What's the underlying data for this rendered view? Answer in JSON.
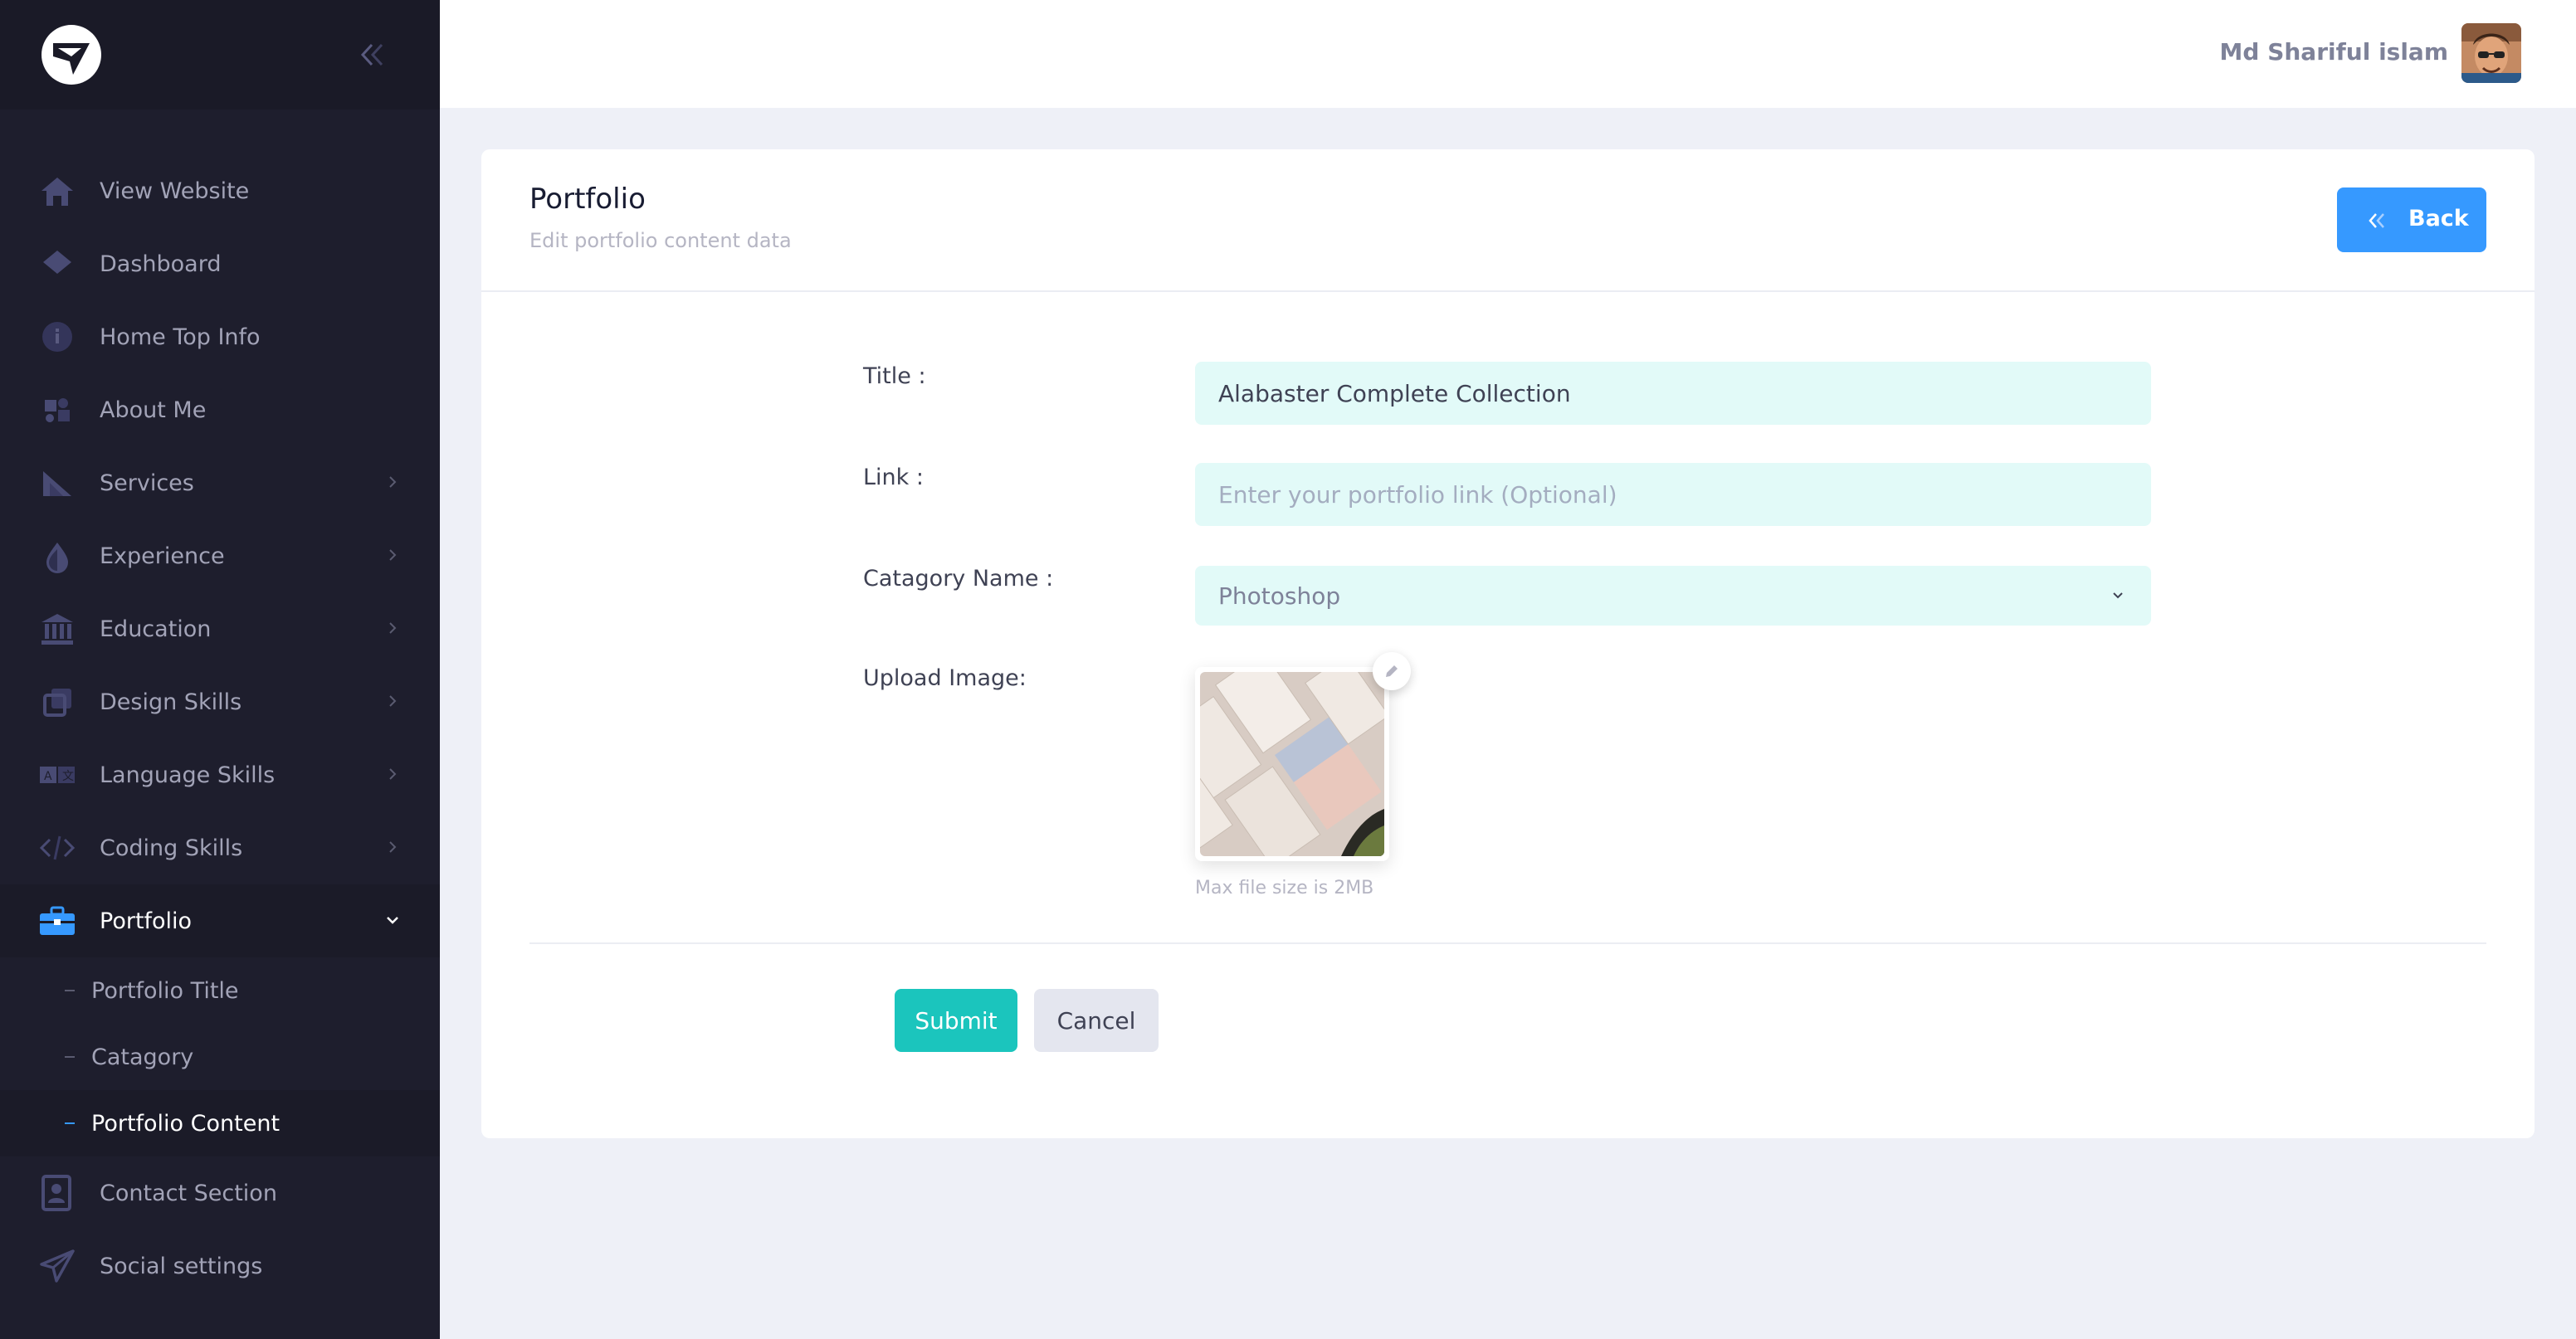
{
  "sidebar": {
    "logo": "logo-icon",
    "items": [
      {
        "label": "View Website",
        "icon": "home-icon"
      },
      {
        "label": "Dashboard",
        "icon": "diamond-icon"
      },
      {
        "label": "Home Top Info",
        "icon": "info-icon"
      },
      {
        "label": "About Me",
        "icon": "puzzle-icon"
      },
      {
        "label": "Services",
        "icon": "sail-icon"
      },
      {
        "label": "Experience",
        "icon": "drop-icon"
      },
      {
        "label": "Education",
        "icon": "bank-icon"
      },
      {
        "label": "Design Skills",
        "icon": "layers-icon"
      },
      {
        "label": "Language Skills",
        "icon": "translate-icon"
      },
      {
        "label": "Coding Skills",
        "icon": "code-icon"
      },
      {
        "label": "Portfolio",
        "icon": "briefcase-icon"
      },
      {
        "label": "Contact Section",
        "icon": "contact-icon"
      },
      {
        "label": "Social settings",
        "icon": "send-icon"
      }
    ],
    "submenu": [
      {
        "label": "Portfolio Title"
      },
      {
        "label": "Catagory"
      },
      {
        "label": "Portfolio Content"
      }
    ]
  },
  "header": {
    "user_name": "Md Shariful islam"
  },
  "card": {
    "title": "Portfolio",
    "subtitle": "Edit portfolio content data",
    "back_label": "Back"
  },
  "form": {
    "title_label": "Title :",
    "title_value": "Alabaster Complete Collection",
    "link_label": "Link :",
    "link_placeholder": "Enter your portfolio link (Optional)",
    "category_label": "Catagory Name :",
    "category_value": "Photoshop",
    "image_label": "Upload Image:",
    "image_hint": "Max file size is 2MB",
    "submit_label": "Submit",
    "cancel_label": "Cancel"
  },
  "colors": {
    "sidebar_bg": "#1e1e2d",
    "primary": "#3699ff",
    "success": "#1bc5bd",
    "input_bg": "#e2faf8"
  }
}
